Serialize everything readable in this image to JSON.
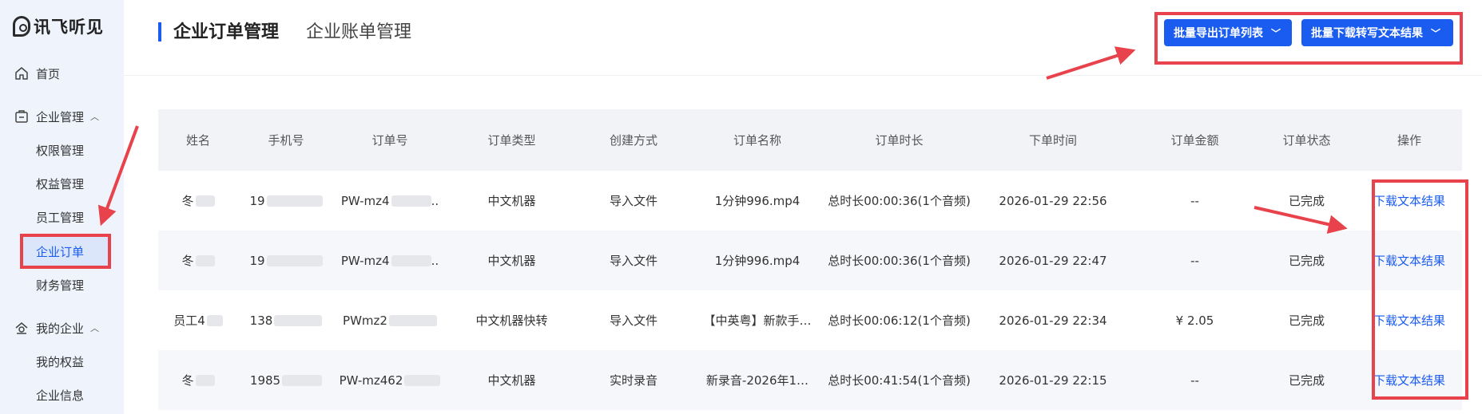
{
  "brand": {
    "name": "讯飞听见"
  },
  "sidebar": {
    "home": "首页",
    "enterprise_mgmt": "企业管理",
    "sub_items": [
      "权限管理",
      "权益管理",
      "员工管理",
      "企业订单",
      "财务管理"
    ],
    "my_enterprise": "我的企业",
    "my_sub_items": [
      "我的权益",
      "企业信息"
    ]
  },
  "header": {
    "tab_active": "企业订单管理",
    "tab_other": "企业账单管理",
    "btn_export": "批量导出订单列表",
    "btn_download": "批量下载转写文本结果"
  },
  "table": {
    "columns": [
      "姓名",
      "手机号",
      "订单号",
      "订单类型",
      "创建方式",
      "订单名称",
      "订单时长",
      "下单时间",
      "订单金额",
      "订单状态",
      "操作"
    ],
    "rows": [
      {
        "name": "冬",
        "phone": "19",
        "order_no": "PW-mz4",
        "type": "中文机器",
        "method": "导入文件",
        "title": "1分钟996.mp4",
        "duration": "总时长00:00:36(1个音频)",
        "time": "2026-01-29 22:56",
        "amount": "--",
        "status": "已完成",
        "op": "下载文本结果"
      },
      {
        "name": "冬",
        "phone": "19",
        "order_no": "PW-mz4",
        "type": "中文机器",
        "method": "导入文件",
        "title": "1分钟996.mp4",
        "duration": "总时长00:00:36(1个音频)",
        "time": "2026-01-29 22:47",
        "amount": "--",
        "status": "已完成",
        "op": "下载文本结果"
      },
      {
        "name": "员工4",
        "phone": "138",
        "order_no": "PWmz2",
        "type": "中文机器快转",
        "method": "导入文件",
        "title": "【中英粤】新款手…",
        "duration": "总时长00:06:12(1个音频)",
        "time": "2026-01-29 22:34",
        "amount": "¥ 2.05",
        "status": "已完成",
        "op": "下载文本结果"
      },
      {
        "name": "冬",
        "phone": "1985",
        "order_no": "PW-mz462",
        "type": "中文机器",
        "method": "实时录音",
        "title": "新录音-2026年1…",
        "duration": "总时长00:41:54(1个音频)",
        "time": "2026-01-29 22:15",
        "amount": "--",
        "status": "已完成",
        "op": "下载文本结果"
      }
    ]
  },
  "colors": {
    "accent": "#1b5cf0",
    "highlight": "#e8434c",
    "sidebar_bg": "#eef3fc"
  }
}
